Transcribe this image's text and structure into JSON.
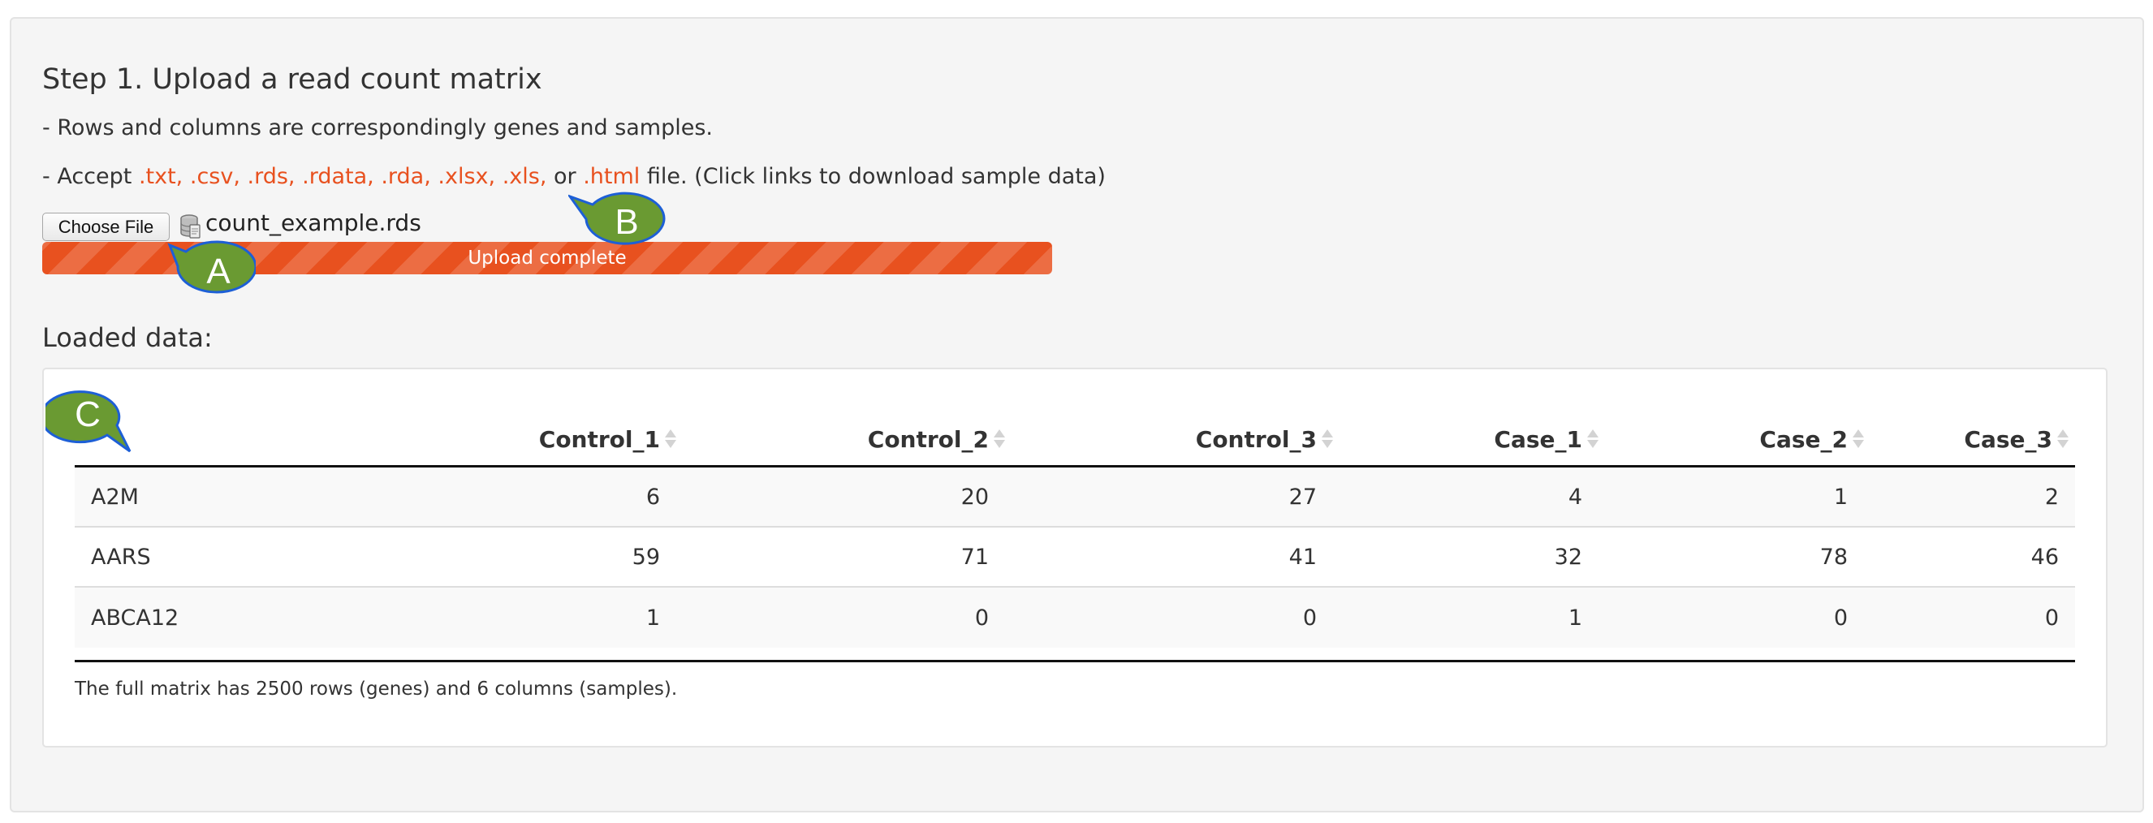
{
  "step": {
    "title": "Step 1. Upload a read count matrix",
    "line1": "- Rows and columns are correspondingly genes and samples.",
    "accept_prefix": "- Accept ",
    "links": [
      ".txt,",
      ".csv,",
      ".rds,",
      ".rdata,",
      ".rda,",
      ".xlsx,",
      ".xls,"
    ],
    "or_text": " or ",
    "html_link": ".html",
    "accept_suffix": " file. (Click links to download sample data)"
  },
  "upload": {
    "button_label": "Choose File",
    "file_name": "count_example.rds",
    "progress_label": "Upload complete",
    "progress_fraction": 1.0,
    "progress_color": "#e8511f"
  },
  "loaded_label": "Loaded data:",
  "table": {
    "columns": [
      "Control_1",
      "Control_2",
      "Control_3",
      "Case_1",
      "Case_2",
      "Case_3"
    ],
    "rows": [
      {
        "gene": "A2M",
        "values": [
          "6",
          "20",
          "27",
          "4",
          "1",
          "2"
        ]
      },
      {
        "gene": "AARS",
        "values": [
          "59",
          "71",
          "41",
          "32",
          "78",
          "46"
        ]
      },
      {
        "gene": "ABCA12",
        "values": [
          "1",
          "0",
          "0",
          "1",
          "0",
          "0"
        ]
      }
    ]
  },
  "summary": "The full matrix has 2500 rows (genes) and 6 columns (samples).",
  "callouts": [
    {
      "label": "A",
      "color": "#6a9a32"
    },
    {
      "label": "B",
      "color": "#6a9a32"
    },
    {
      "label": "C",
      "color": "#6a9a32"
    }
  ]
}
